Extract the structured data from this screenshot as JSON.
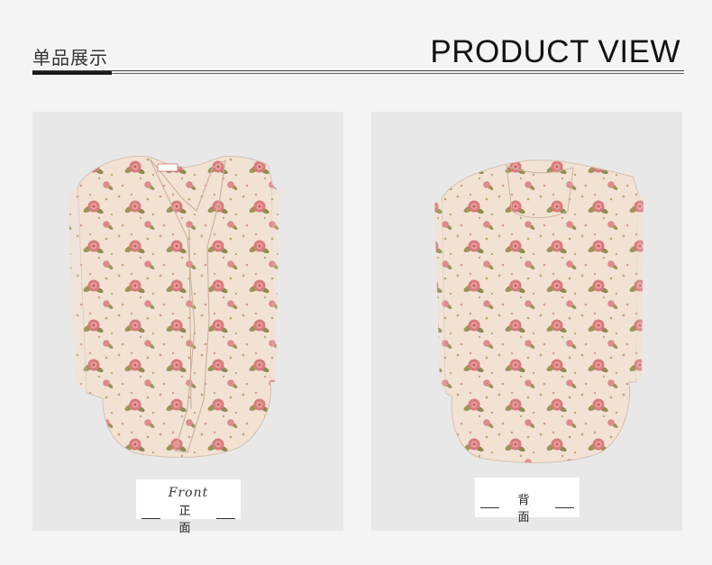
{
  "header": {
    "cn_title": "单品展示",
    "en_title": "PRODUCT VIEW"
  },
  "panels": {
    "front": {
      "script_label": "Front",
      "caption": "正 面"
    },
    "back": {
      "caption": "背 面"
    }
  },
  "colors": {
    "background": "#f4f4f4",
    "panel": "#e8e8e8",
    "fabric": "#f1e2d4",
    "rose": "#d97a7c",
    "leaf": "#9d9457"
  },
  "icons": [
    "divider-rule",
    "front-blouse-image",
    "back-blouse-image"
  ]
}
